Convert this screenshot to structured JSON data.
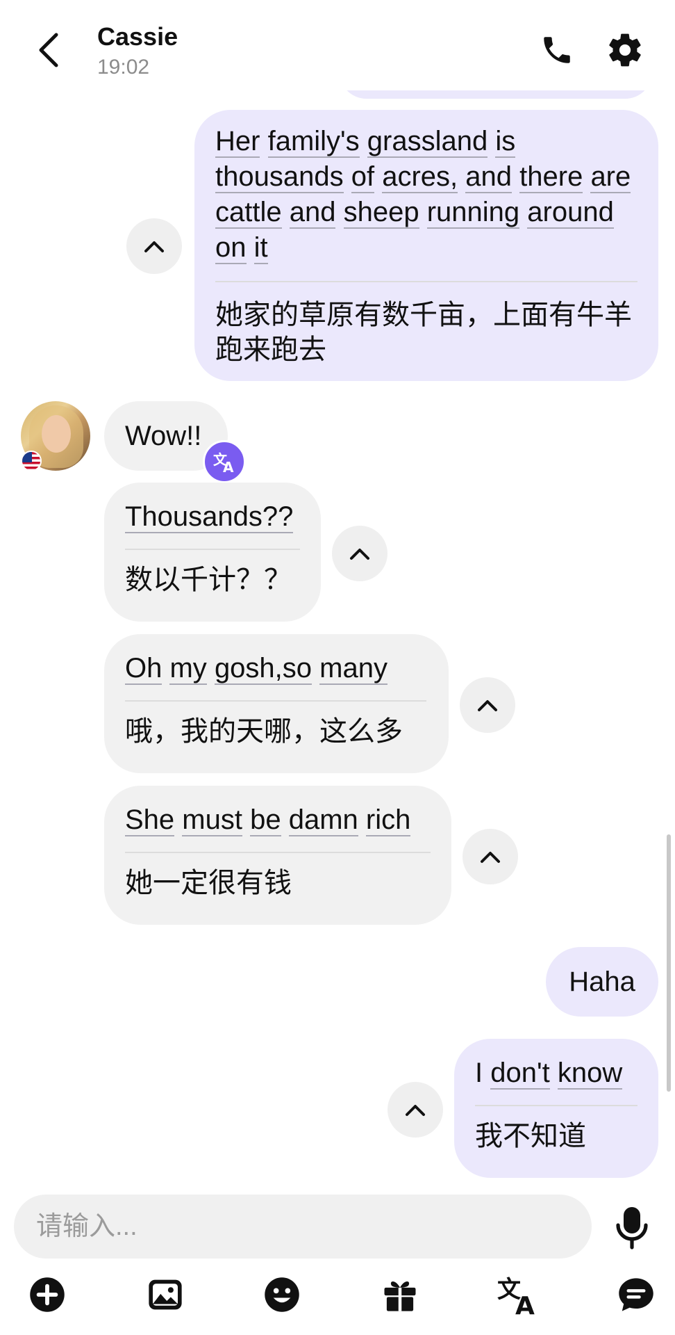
{
  "header": {
    "contact_name": "Cassie",
    "time": "19:02"
  },
  "messages": [
    {
      "direction": "sent",
      "original_words": [
        "Her",
        "family's",
        "grassland",
        "is",
        "thousands",
        "of",
        "acres,",
        "and",
        "there",
        "are",
        "cattle",
        "and",
        "sheep",
        "running",
        "around",
        "on",
        "it"
      ],
      "translation": "她家的草原有数千亩，上面有牛羊跑来跑去"
    },
    {
      "direction": "received",
      "original": "Wow!!"
    },
    {
      "direction": "received",
      "original_words": [
        "Thousands??"
      ],
      "translation": "数以千计？？"
    },
    {
      "direction": "received",
      "original_words": [
        "Oh",
        "my",
        "gosh,so",
        "many"
      ],
      "translation": "哦，我的天哪，这么多"
    },
    {
      "direction": "received",
      "original_words": [
        "She",
        "must",
        "be",
        "damn",
        "rich"
      ],
      "translation": "她一定很有钱"
    },
    {
      "direction": "sent",
      "original": "Haha"
    },
    {
      "direction": "sent",
      "original_words": [
        "I",
        "don't",
        "know"
      ],
      "translation": "我不知道"
    }
  ],
  "composer": {
    "placeholder": "请输入..."
  },
  "toolbar_icons": [
    "plus-circle-icon",
    "image-icon",
    "emoji-icon",
    "gift-icon",
    "translate-icon",
    "chat-bubble-icon"
  ],
  "colors": {
    "sent_bubble": "#ebe8fc",
    "received_bubble": "#f1f1f1",
    "accent": "#7a5cf0"
  }
}
